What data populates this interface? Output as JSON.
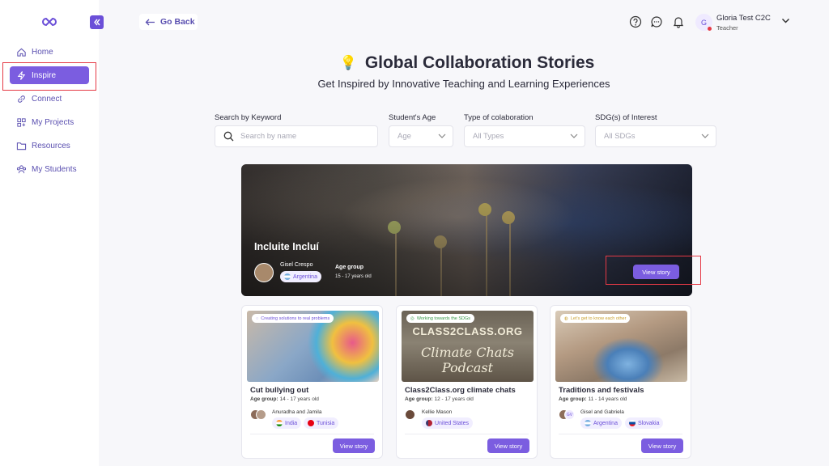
{
  "sidebar": {
    "items": [
      {
        "label": "Home",
        "icon": "home-icon"
      },
      {
        "label": "Inspire",
        "icon": "lightning-icon",
        "active": true
      },
      {
        "label": "Connect",
        "icon": "link-icon"
      },
      {
        "label": "My Projects",
        "icon": "projects-icon"
      },
      {
        "label": "Resources",
        "icon": "folder-icon"
      },
      {
        "label": "My Students",
        "icon": "students-icon"
      }
    ]
  },
  "topbar": {
    "go_back": "Go Back",
    "user": {
      "initial": "G",
      "name": "Gloria Test C2C",
      "role": "Teacher"
    }
  },
  "header": {
    "title": "Global Collaboration Stories",
    "subtitle": "Get Inspired by Innovative Teaching and Learning Experiences"
  },
  "filters": {
    "keyword": {
      "label": "Search by Keyword",
      "placeholder": "Search by name"
    },
    "age": {
      "label": "Student's Age",
      "value": "Age"
    },
    "type": {
      "label": "Type of colaboration",
      "value": "All Types"
    },
    "sdg": {
      "label": "SDG(s) of Interest",
      "value": "All SDGs"
    }
  },
  "hero": {
    "title": "Incluite Incluí",
    "author": "Gisel Crespo",
    "country": "Argentina",
    "age_label": "Age group",
    "age_value": "15 - 17 years old",
    "button": "View story"
  },
  "cards": [
    {
      "tag": "Creating solutions to real problems",
      "title": "Cut bullying out",
      "age_label": "Age group:",
      "age_value": "14 - 17 years old",
      "names": "Anuradha and Jamila",
      "countries": [
        "India",
        "Tunisia"
      ],
      "button": "View story"
    },
    {
      "tag": "Working towards the SDGs",
      "title": "Class2Class.org climate chats",
      "age_label": "Age group:",
      "age_value": "12 - 17 years old",
      "names": "Kellie Mason",
      "countries": [
        "United States"
      ],
      "button": "View story",
      "image_text_1": "CLASS2CLASS.ORG",
      "image_text_2": "Climate Chats Podcast"
    },
    {
      "tag": "Let's get to know each other",
      "title": "Traditions and festivals",
      "age_label": "Age group:",
      "age_value": "11 - 14 years old",
      "names": "Gisel and Gabriela",
      "avatar_initials": "GV",
      "countries": [
        "Argentina",
        "Slovakia"
      ],
      "button": "View story"
    }
  ],
  "colors": {
    "accent": "#7b5de0",
    "highlight": "#e53945"
  }
}
